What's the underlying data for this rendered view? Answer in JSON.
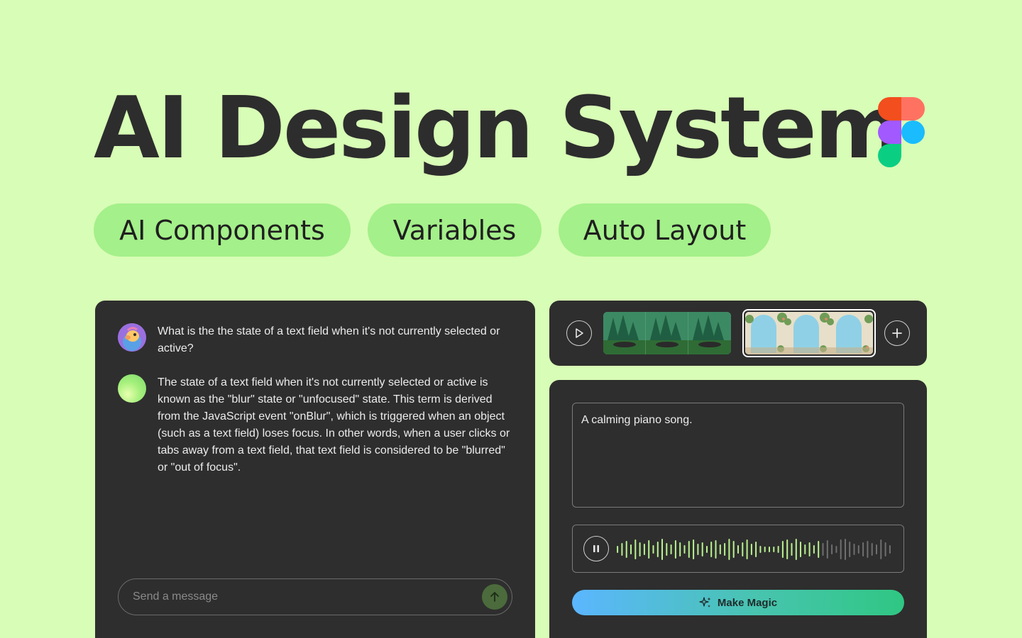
{
  "hero": {
    "title": "AI Design System",
    "logo": "figma-logo"
  },
  "tags": [
    "AI Components",
    "Variables",
    "Auto Layout"
  ],
  "chat": {
    "messages": [
      {
        "role": "user",
        "avatar": "user-avatar",
        "text": "What is the the state of a text field when it's not currently selected or active?"
      },
      {
        "role": "assistant",
        "avatar": "ai-orb-avatar",
        "text": "The state of a text field when it's not currently selected or active is known as the \"blur\" state or \"unfocused\" state. This term is derived from the JavaScript event \"onBlur\", which is triggered when an object (such as a text field) loses focus. In other words, when a user clicks or tabs away from a text field, that text field is considered to be \"blurred\" or \"out of focus\"."
      }
    ],
    "input_placeholder": "Send a message",
    "icons": {
      "send": "arrow-up-icon"
    }
  },
  "media_strip": {
    "icons": {
      "play": "play-icon",
      "add": "plus-icon"
    },
    "thumbnails": [
      "forest-scene-thumbnail",
      "garden-arches-thumbnail"
    ],
    "selected_index": 1
  },
  "music": {
    "prompt": "A calming piano song.",
    "player": {
      "state": "playing",
      "icon": "pause-icon",
      "progress": 0.74
    },
    "button_label": "Make Magic",
    "button_icon": "sparkles-icon"
  },
  "colors": {
    "background": "#d8fdb6",
    "pill": "#a4f08a",
    "panel": "#2e2e2e",
    "wave_active": "#b9f28f",
    "wave_inactive": "#6f6f6f",
    "magic_gradient_start": "#5bb6ff",
    "magic_gradient_end": "#2fc783"
  }
}
